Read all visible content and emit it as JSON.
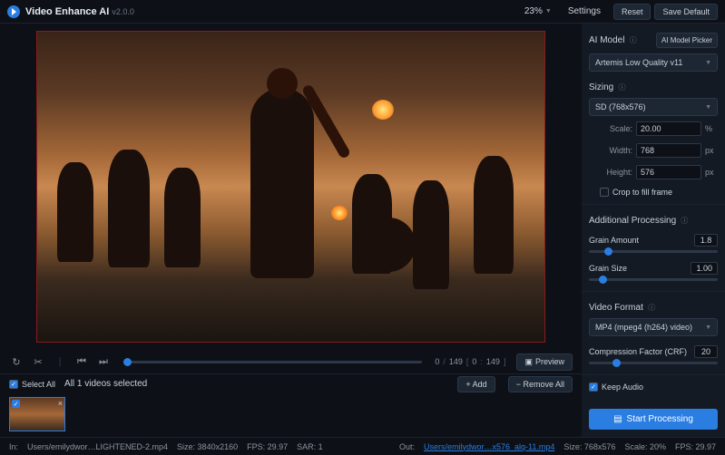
{
  "titlebar": {
    "app_name": "Video Enhance AI",
    "version": "v2.0.0",
    "zoom": "23%",
    "settings": "Settings",
    "reset": "Reset",
    "save_default": "Save Default"
  },
  "controls": {
    "current_frame": "0",
    "total_frames": "149",
    "range_start": "0",
    "range_end": "149",
    "preview_btn": "Preview"
  },
  "library": {
    "select_all": "Select All",
    "selected_text": "All 1 videos selected",
    "add": "Add",
    "remove_all": "Remove All"
  },
  "panel": {
    "ai_model": {
      "label": "AI Model",
      "picker": "AI Model Picker",
      "selected": "Artemis Low Quality v11"
    },
    "sizing": {
      "label": "Sizing",
      "preset": "SD (768x576)",
      "scale_label": "Scale:",
      "scale_value": "20.00",
      "scale_unit": "%",
      "width_label": "Width:",
      "width_value": "768",
      "width_unit": "px",
      "height_label": "Height:",
      "height_value": "576",
      "height_unit": "px",
      "crop_label": "Crop to fill frame"
    },
    "processing": {
      "label": "Additional Processing",
      "grain_amount_label": "Grain Amount",
      "grain_amount_value": "1.8",
      "grain_size_label": "Grain Size",
      "grain_size_value": "1.00"
    },
    "video_format": {
      "label": "Video Format",
      "selected": "MP4 (mpeg4 (h264) video)",
      "crf_label": "Compression Factor (CRF)",
      "crf_value": "20"
    },
    "keep_audio": "Keep Audio",
    "start": "Start Processing"
  },
  "status": {
    "in_label": "In:",
    "in_file": "Users/emilydwor…LIGHTENED-2.mp4",
    "in_size": "Size: 3840x2160",
    "in_fps": "FPS: 29.97",
    "in_sar": "SAR: 1",
    "out_label": "Out:",
    "out_file": "Users/emilydwor…x576_alq-11.mp4",
    "out_size": "Size: 768x576",
    "out_scale": "Scale: 20%",
    "out_fps": "FPS: 29.97"
  }
}
